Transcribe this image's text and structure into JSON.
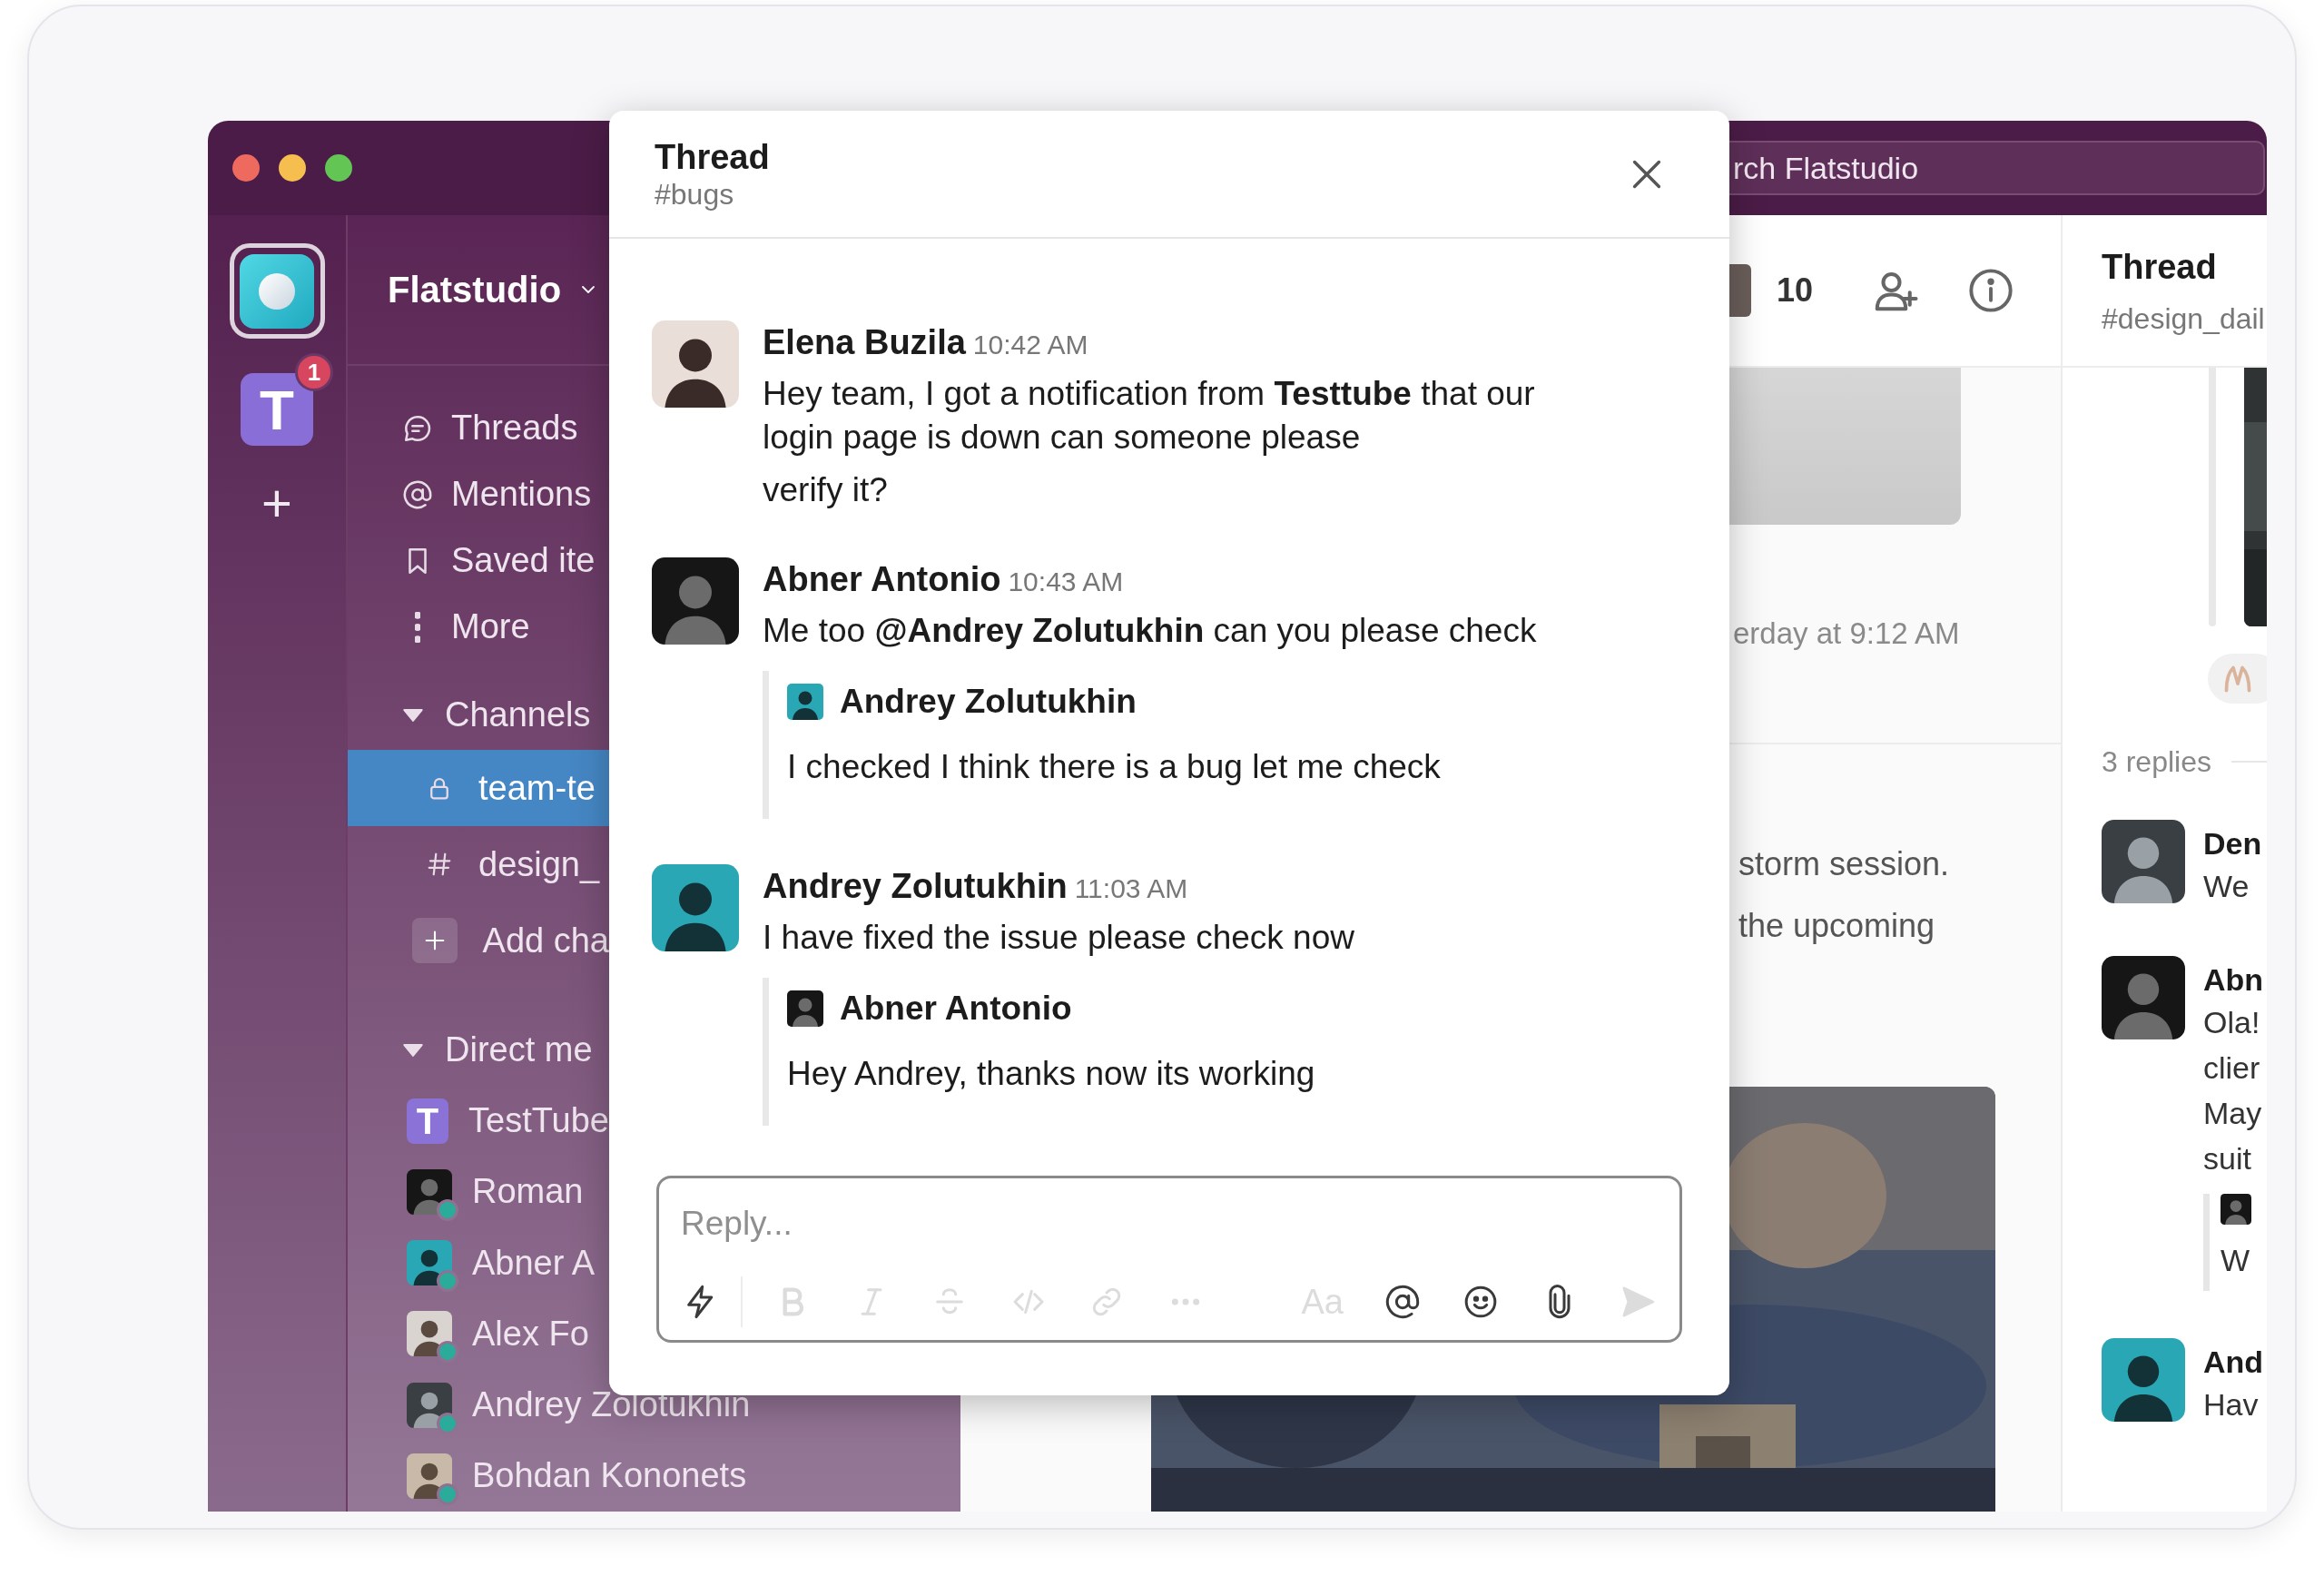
{
  "rail": [
    {
      "kind": "workspace",
      "selected": true
    },
    {
      "kind": "letter",
      "letter": "T",
      "badge": "1",
      "selected": false
    },
    {
      "kind": "add",
      "glyph": "+"
    }
  ],
  "sidebar": {
    "workspace": "Flatstudio",
    "nav": [
      {
        "label": "Threads",
        "selected": false
      },
      {
        "label": "Mentions",
        "selected": false
      },
      {
        "label": "Saved ite",
        "selected": false
      },
      {
        "label": "More",
        "selected": false
      }
    ],
    "sections": [
      {
        "title": "Channels",
        "expanded": true,
        "items": [
          {
            "kind": "private",
            "label": "team-te",
            "selected": true
          },
          {
            "kind": "public",
            "label": "design_",
            "selected": false
          },
          {
            "kind": "add",
            "label": "Add cha",
            "selected": false
          }
        ]
      },
      {
        "title": "Direct me",
        "expanded": true,
        "items": [
          {
            "kind": "app",
            "letter": "T",
            "label": "TestTube",
            "selected": false
          },
          {
            "kind": "person",
            "label": "Roman",
            "online": true,
            "selected": false
          },
          {
            "kind": "person",
            "label": "Abner A",
            "online": true,
            "selected": false
          },
          {
            "kind": "person",
            "label": "Alex Fo",
            "online": true,
            "selected": false
          },
          {
            "kind": "person",
            "label": "Andrey Zolotukhin",
            "online": true,
            "selected": false
          },
          {
            "kind": "person",
            "label": "Bohdan Kononets",
            "online": true,
            "selected": false
          }
        ]
      }
    ]
  },
  "main": {
    "search": {
      "placeholder": "rch Flatstudio"
    },
    "member_count": "10",
    "timestamp": "erday at 9:12 AM",
    "text_lines": [
      "storm session.",
      "the upcoming"
    ]
  },
  "thread_pane": {
    "title": "Thread",
    "channel": "#design_dail",
    "reply_count": "3 replies",
    "replies": [
      {
        "name": "Den",
        "lines": [
          "We"
        ]
      },
      {
        "name": "Abn",
        "lines": [
          "Ola!",
          "clier",
          "May",
          "suit"
        ],
        "quote_lines": [
          "W"
        ]
      },
      {
        "name": "And",
        "lines": [
          "Hav"
        ]
      }
    ]
  },
  "modal": {
    "title": "Thread",
    "channel": "#bugs",
    "messages": [
      {
        "author": "Elena Buzila",
        "time": "10:42 AM",
        "lines": [
          "Hey team, I got a notification from **Testtube** that our login page is down can someone please",
          "verify it?"
        ]
      },
      {
        "author": "Abner Antonio",
        "time": "10:43 AM",
        "lines": [
          "Me too **@Andrey Zolutukhin** can you please check"
        ],
        "quote": {
          "author": "Andrey Zolutukhin",
          "text": "I checked I think there is a bug let me check"
        }
      },
      {
        "author": "Andrey Zolutukhin",
        "time": "11:03 AM",
        "lines": [
          "I have fixed the issue please check now"
        ],
        "quote": {
          "author": "Abner Antonio",
          "text": "Hey Andrey, thanks now its working"
        }
      }
    ],
    "composer": {
      "placeholder": "Reply...",
      "tools": [
        {
          "disabled": false
        },
        {
          "disabled": true
        },
        {
          "disabled": true
        },
        {
          "disabled": true
        },
        {
          "disabled": true
        },
        {
          "disabled": true
        },
        {
          "disabled": true
        },
        {
          "label": "Aa",
          "disabled": true
        },
        {
          "disabled": false
        },
        {
          "disabled": false
        },
        {
          "disabled": false
        },
        {
          "disabled": true
        }
      ]
    }
  }
}
